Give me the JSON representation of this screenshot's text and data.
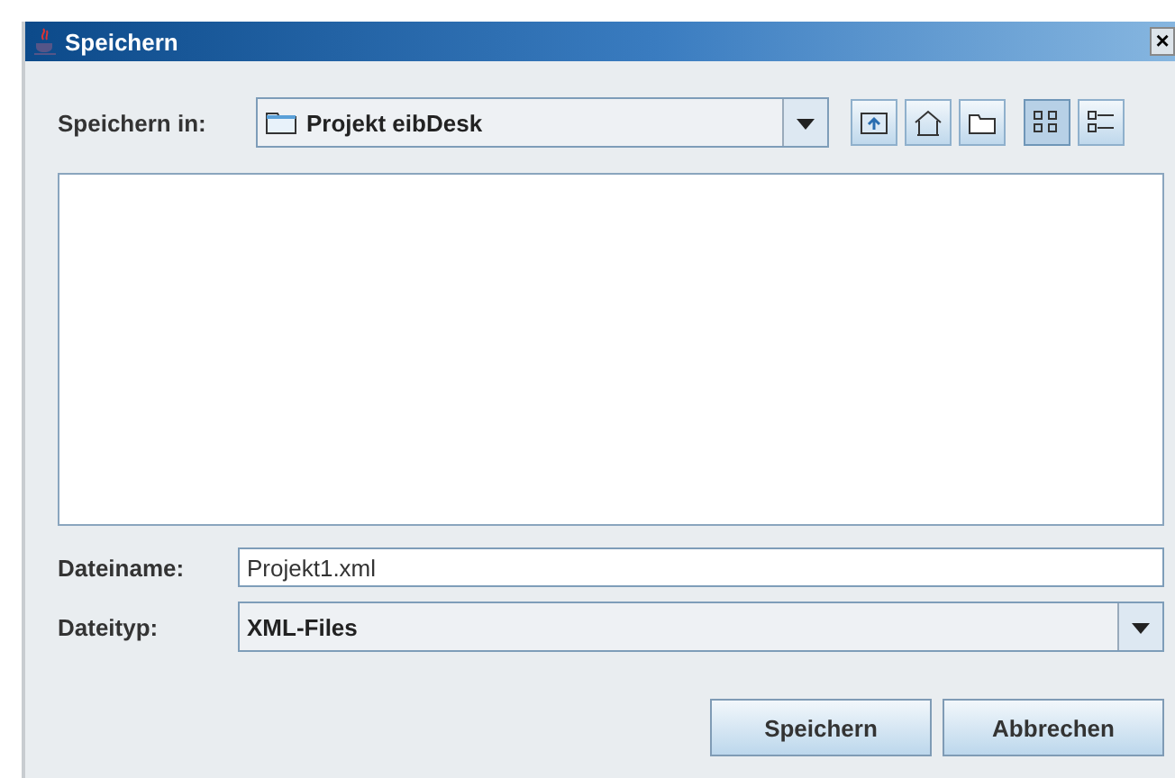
{
  "window": {
    "title": "Speichern",
    "close": "×"
  },
  "look_in": {
    "label": "Speichern in:",
    "value": "Projekt eibDesk"
  },
  "toolbar": [
    {
      "kind": "up",
      "selected": false
    },
    {
      "kind": "home",
      "selected": false
    },
    {
      "kind": "newfolder",
      "selected": false
    },
    {
      "kind": "list",
      "selected": true
    },
    {
      "kind": "details",
      "selected": false
    }
  ],
  "file_name": {
    "label": "Dateiname:",
    "value": "Projekt1.xml"
  },
  "file_type": {
    "label": "Dateityp:",
    "value": "XML-Files"
  },
  "buttons": [
    "Speichern",
    "Abbrechen"
  ]
}
